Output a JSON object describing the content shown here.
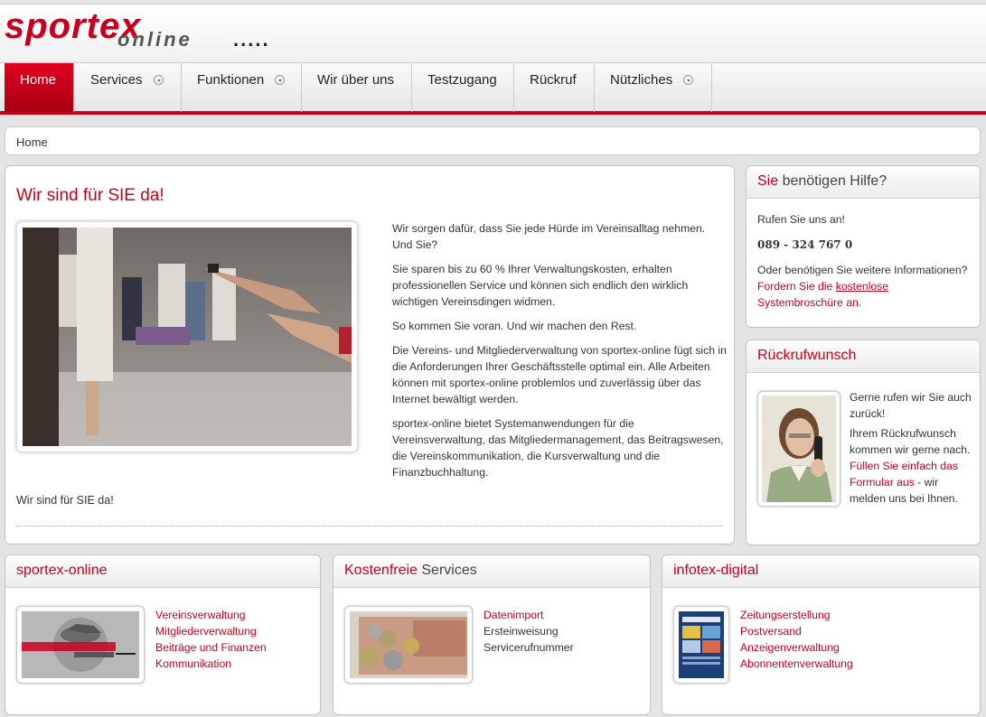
{
  "logo": {
    "word1": "sportex",
    "word2": "online",
    "dots": "....."
  },
  "nav": [
    {
      "label": "Home",
      "active": true,
      "dropdown": false
    },
    {
      "label": "Services",
      "active": false,
      "dropdown": true
    },
    {
      "label": "Funktionen",
      "active": false,
      "dropdown": true
    },
    {
      "label": "Wir über uns",
      "active": false,
      "dropdown": false
    },
    {
      "label": "Testzugang",
      "active": false,
      "dropdown": false
    },
    {
      "label": "Rückruf",
      "active": false,
      "dropdown": false
    },
    {
      "label": "Nützliches",
      "active": false,
      "dropdown": true
    }
  ],
  "breadcrumb": "Home",
  "main": {
    "title": "Wir sind für SIE da!",
    "paragraphs": [
      "Wir sorgen dafür, dass Sie jede Hürde im Vereinsalltag nehmen. Und Sie?",
      "Sie sparen bis zu 60 % Ihrer Verwaltungskosten, erhalten professionellen Service und können sich endlich den wirklich wichtigen Vereinsdingen widmen.",
      "So kommen Sie voran. Und wir machen den Rest.",
      "Die Vereins- und Mitgliederverwaltung von sportex-online fügt sich in die Anforderungen Ihrer Geschäftsstelle optimal ein. Alle Arbeiten können mit sportex-online problemlos und zuverlässig über das Internet bewältigt werden.",
      "sportex-online bietet Systemanwendungen für die Vereinsverwaltung, das Mitgliedermanagement, das Beitragswesen, die Vereinskommunikation, die Kursverwaltung und die Finanzbuchhaltung."
    ],
    "footline": "Wir sind für SIE da!"
  },
  "help": {
    "title_red": "Sie",
    "title_rest": " benötigen Hilfe?",
    "call": "Rufen Sie uns an!",
    "phone": "089 - 324 767 0",
    "more_1": "Oder benötigen Sie weitere Informationen? ",
    "more_link_1": "Fordern Sie die ",
    "more_link_2": "kostenlose",
    "more_link_3": " Systembroschüre an."
  },
  "callback": {
    "title": "Rückrufwunsch",
    "p1": "Gerne rufen wir Sie auch zurück!",
    "p2a": "Ihrem Rückrufwunsch kommen wir gerne nach. ",
    "p2link": "Füllen Sie einfach das Formular aus",
    "p2b": " - wir melden uns bei Ihnen."
  },
  "boxes": [
    {
      "title_red": "sportex-online",
      "title_rest": "",
      "links": [
        "Vereinsverwaltung",
        "Mitgliederverwaltung",
        "Beiträge und Finanzen",
        "Kommunikation"
      ]
    },
    {
      "title_red": "Kostenfreie",
      "title_rest": " Services",
      "links": [
        "Datenimport",
        "Ersteinweisung",
        "Servicerufnummer"
      ]
    },
    {
      "title_red": "infotex-digital",
      "title_rest": "",
      "links": [
        "Zeitungserstellung",
        "Postversand",
        "Anzeigenverwaltung",
        "Abonnentenverwaltung"
      ]
    }
  ],
  "colors": {
    "accent": "#c8001e",
    "background": "#e4e4e4"
  }
}
